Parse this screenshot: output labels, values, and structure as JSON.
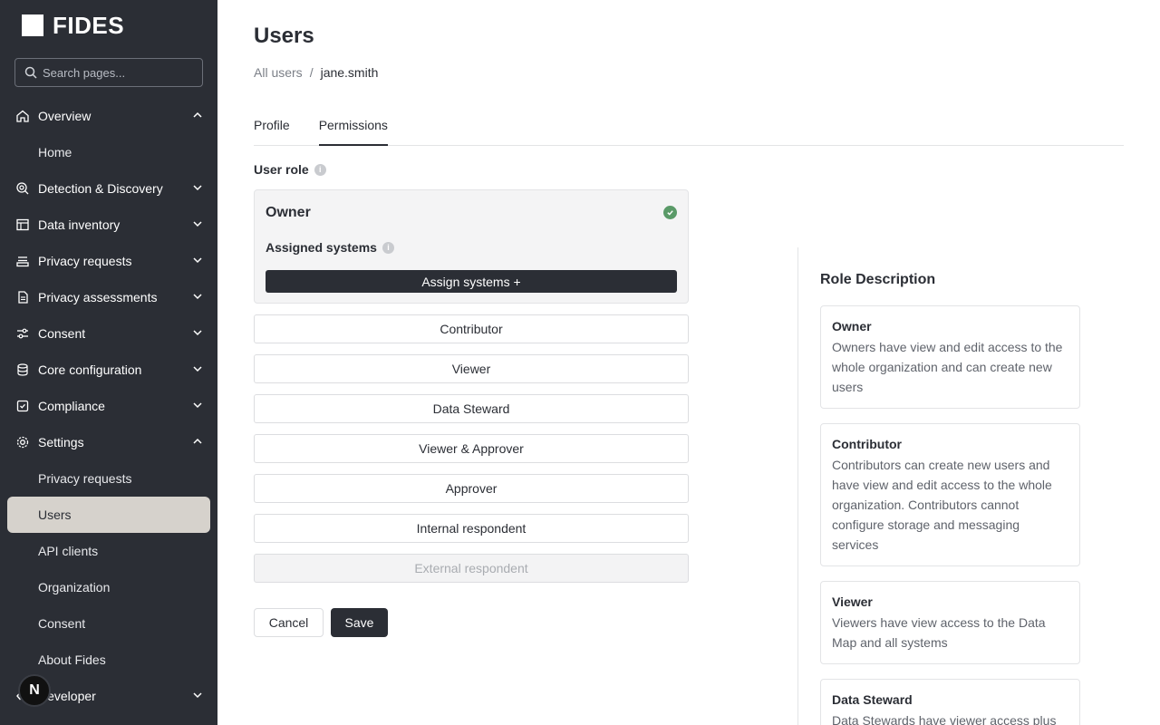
{
  "brand": {
    "name": "FIDES"
  },
  "search": {
    "placeholder": "Search pages..."
  },
  "nav": {
    "overview": "Overview",
    "home": "Home",
    "detection": "Detection & Discovery",
    "data_inventory": "Data inventory",
    "privacy_requests": "Privacy requests",
    "privacy_assessments": "Privacy assessments",
    "consent": "Consent",
    "core_configuration": "Core configuration",
    "compliance": "Compliance",
    "settings": "Settings",
    "settings_items": {
      "privacy_requests": "Privacy requests",
      "users": "Users",
      "api_clients": "API clients",
      "organization": "Organization",
      "consent": "Consent",
      "about": "About Fides"
    },
    "developer": "Developer"
  },
  "floating_badge": "N",
  "page": {
    "title": "Users",
    "breadcrumb": {
      "root": "All users",
      "separator": "/",
      "current": "jane.smith"
    },
    "tabs": {
      "profile": "Profile",
      "permissions": "Permissions"
    },
    "user_role_label": "User role",
    "info_glyph": "i",
    "selected_role": {
      "name": "Owner",
      "assigned_systems_label": "Assigned systems",
      "assign_button": "Assign systems +"
    },
    "roles": {
      "contributor": "Contributor",
      "viewer": "Viewer",
      "data_steward": "Data Steward",
      "viewer_approver": "Viewer & Approver",
      "approver": "Approver",
      "internal_respondent": "Internal respondent",
      "external_respondent": "External respondent"
    },
    "cancel": "Cancel",
    "save": "Save"
  },
  "role_description": {
    "title": "Role Description",
    "owner": {
      "name": "Owner",
      "text": "Owners have view and edit access to the whole organization and can create new users"
    },
    "contributor": {
      "name": "Contributor",
      "text": "Contributors can create new users and have view and edit access to the whole organization. Contributors cannot configure storage and messaging services"
    },
    "viewer": {
      "name": "Viewer",
      "text": "Viewers have view access to the Data Map and all systems"
    },
    "data_steward": {
      "name": "Data Steward",
      "text": "Data Stewards have viewer access plus"
    }
  },
  "icons": {
    "search": "search-icon",
    "home": "home-icon",
    "detection": "radar-icon",
    "inventory": "table-icon",
    "requests": "inbox-icon",
    "assessments": "document-icon",
    "consent": "sliders-icon",
    "core": "database-icon",
    "compliance": "shield-icon",
    "settings": "gear-icon"
  },
  "colors": {
    "sidebar": "#2b2e35",
    "active_item": "#d6d2cc",
    "success": "#5a9a68",
    "primary": "#2b2e35"
  }
}
